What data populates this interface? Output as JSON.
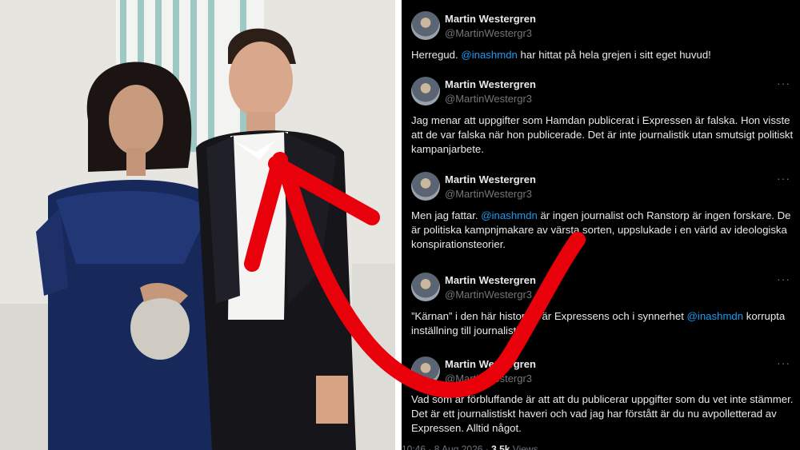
{
  "tweets": [
    {
      "author": "Martin Westergren",
      "handle": "@MartinWestergr3",
      "text_before": "Herregud. ",
      "mention": "@inashmdn",
      "text_after": " har hittat på hela grejen i sitt eget huvud!"
    },
    {
      "author": "Martin Westergren",
      "handle": "@MartinWestergr3",
      "more": "···",
      "text": "Jag menar att uppgifter som Hamdan publicerat i Expressen är falska. Hon visste att de var falska när hon publicerade. Det är inte journalistik utan smutsigt politiskt kampanjarbete."
    },
    {
      "author": "Martin Westergren",
      "handle": "@MartinWestergr3",
      "more": "···",
      "text_before": "Men jag fattar. ",
      "mention": "@inashmdn",
      "text_after": " är ingen journalist och Ranstorp är ingen forskare. De är politiska kampnjmakare av värsta sorten, uppslukade i en värld av ideologiska konspirationsteorier."
    },
    {
      "author": "Martin Westergren",
      "handle": "@MartinWestergr3",
      "more": "···",
      "text_before": "”Kärnan” i den här historien är Expressens och i synnerhet ",
      "mention": "@inashmdn",
      "text_after": " korrupta inställning till journalistik."
    },
    {
      "author": "Martin Westergren",
      "handle": "@MartinWestergr3",
      "more": "···",
      "text": "Vad som är förbluffande är att att du publicerar uppgifter som du vet inte stämmer. Det är ett journalistiskt haveri och vad jag har förstått är du nu avpolletterad av Expressen. Alltid något."
    }
  ],
  "footer": {
    "time": "10:46 · 8 Aug 2026 · ",
    "views_count": "3,5k",
    "views_label": " Views"
  },
  "colors": {
    "background": "#000000",
    "text": "#e7e9ea",
    "secondary": "#71767b",
    "mention": "#1d9bf0",
    "arrow": "#e8000b"
  }
}
